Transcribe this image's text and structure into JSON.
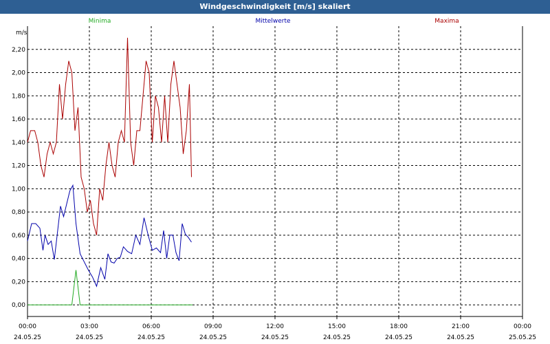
{
  "window": {
    "title": "Windgeschwindigkeit [m/s] skaliert"
  },
  "chart_data": {
    "type": "line",
    "title": "Windgeschwindigkeit [m/s] skaliert",
    "ylabel": "m/s",
    "ylim": [
      -0.1,
      2.4
    ],
    "y_ticks": [
      "0,00",
      "0,20",
      "0,40",
      "0,60",
      "0,80",
      "1,00",
      "1,20",
      "1,40",
      "1,60",
      "1,80",
      "2,00",
      "2,20"
    ],
    "y_tick_values": [
      0,
      0.2,
      0.4,
      0.6,
      0.8,
      1.0,
      1.2,
      1.4,
      1.6,
      1.8,
      2.0,
      2.2
    ],
    "xlim": [
      0,
      24
    ],
    "x_ticks": [
      {
        "time": "00:00",
        "date": "24.05.25",
        "hour": 0
      },
      {
        "time": "03:00",
        "date": "24.05.25",
        "hour": 3
      },
      {
        "time": "06:00",
        "date": "24.05.25",
        "hour": 6
      },
      {
        "time": "09:00",
        "date": "24.05.25",
        "hour": 9
      },
      {
        "time": "12:00",
        "date": "24.05.25",
        "hour": 12
      },
      {
        "time": "15:00",
        "date": "24.05.25",
        "hour": 15
      },
      {
        "time": "18:00",
        "date": "24.05.25",
        "hour": 18
      },
      {
        "time": "21:00",
        "date": "24.05.25",
        "hour": 21
      },
      {
        "time": "00:00",
        "date": "25.05.25",
        "hour": 24
      }
    ],
    "grid": true,
    "legend_position": "top",
    "series": [
      {
        "name": "Minima",
        "color": "#22aa22",
        "x": [
          0,
          1,
          2,
          2.15,
          2.35,
          2.55,
          2.8,
          4,
          6,
          8
        ],
        "y": [
          0,
          0,
          0,
          0,
          0.3,
          0,
          0,
          0,
          0,
          0
        ]
      },
      {
        "name": "Mittelwerte",
        "color": "#0000aa",
        "x": [
          0,
          0.2,
          0.4,
          0.6,
          0.75,
          0.85,
          1.0,
          1.15,
          1.3,
          1.45,
          1.6,
          1.75,
          1.9,
          2.05,
          2.2,
          2.35,
          2.55,
          2.75,
          2.95,
          3.15,
          3.35,
          3.55,
          3.75,
          3.9,
          4.05,
          4.2,
          4.35,
          4.5,
          4.65,
          4.85,
          5.05,
          5.25,
          5.45,
          5.65,
          5.85,
          6.05,
          6.25,
          6.45,
          6.6,
          6.75,
          6.9,
          7.05,
          7.2,
          7.35,
          7.5,
          7.65,
          7.8,
          7.95
        ],
        "y": [
          0.55,
          0.7,
          0.7,
          0.66,
          0.47,
          0.6,
          0.52,
          0.55,
          0.39,
          0.62,
          0.85,
          0.76,
          0.87,
          0.98,
          1.03,
          0.7,
          0.44,
          0.37,
          0.3,
          0.24,
          0.16,
          0.32,
          0.22,
          0.44,
          0.37,
          0.36,
          0.4,
          0.41,
          0.5,
          0.46,
          0.44,
          0.6,
          0.52,
          0.75,
          0.6,
          0.47,
          0.49,
          0.45,
          0.64,
          0.4,
          0.6,
          0.6,
          0.45,
          0.38,
          0.7,
          0.61,
          0.58,
          0.54
        ]
      },
      {
        "name": "Maxima",
        "color": "#aa0000",
        "x": [
          0,
          0.15,
          0.35,
          0.5,
          0.65,
          0.8,
          0.95,
          1.1,
          1.25,
          1.4,
          1.55,
          1.7,
          1.85,
          2.0,
          2.15,
          2.3,
          2.45,
          2.6,
          2.75,
          2.9,
          3.05,
          3.2,
          3.35,
          3.5,
          3.65,
          3.8,
          3.95,
          4.1,
          4.25,
          4.4,
          4.55,
          4.7,
          4.85,
          5.0,
          5.15,
          5.3,
          5.45,
          5.6,
          5.75,
          5.9,
          6.05,
          6.2,
          6.35,
          6.5,
          6.65,
          6.8,
          6.95,
          7.1,
          7.25,
          7.4,
          7.55,
          7.7,
          7.85,
          7.95
        ],
        "y": [
          1.4,
          1.5,
          1.5,
          1.4,
          1.2,
          1.1,
          1.3,
          1.4,
          1.3,
          1.4,
          1.9,
          1.6,
          1.9,
          2.1,
          2.0,
          1.5,
          1.7,
          1.1,
          1.0,
          0.8,
          0.9,
          0.7,
          0.6,
          1.0,
          0.9,
          1.2,
          1.4,
          1.2,
          1.1,
          1.4,
          1.5,
          1.4,
          2.3,
          1.4,
          1.2,
          1.5,
          1.5,
          1.8,
          2.1,
          2.0,
          1.4,
          1.8,
          1.7,
          1.4,
          1.8,
          1.4,
          1.9,
          2.1,
          1.9,
          1.7,
          1.3,
          1.5,
          1.9,
          1.1
        ]
      }
    ]
  }
}
